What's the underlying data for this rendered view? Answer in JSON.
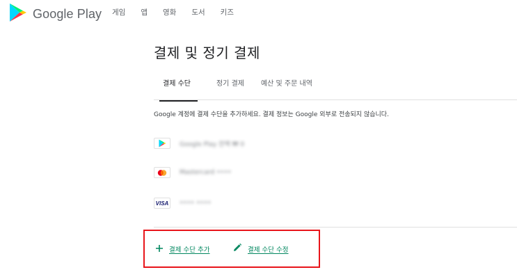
{
  "header": {
    "app_name": "Google Play",
    "nav": [
      "게임",
      "앱",
      "영화",
      "도서",
      "키즈"
    ]
  },
  "page": {
    "title": "결제 및 정기 결제"
  },
  "tabs": [
    {
      "label": "결제 수단",
      "active": true
    },
    {
      "label": "정기 결제",
      "active": false
    },
    {
      "label": "예산 및 주문 내역",
      "active": false
    }
  ],
  "info_text": "Google 계정에 결제 수단을 추가하세요. 결제 정보는 Google 외부로 전송되지 않습니다.",
  "payment_methods": [
    {
      "icon": "google-play-icon",
      "label": "Google Play 잔액 ₩ 0"
    },
    {
      "icon": "mastercard-icon",
      "label": "Mastercard ••••"
    },
    {
      "icon": "visa-icon",
      "icon_text": "VISA",
      "label": "•••• ••••"
    }
  ],
  "actions": {
    "add_label": "결제 수단 추가",
    "edit_label": "결제 수단 수정"
  },
  "colors": {
    "accent": "#01875f",
    "highlight": "#e8141a",
    "text_primary": "#202124",
    "text_secondary": "#5f6368"
  }
}
